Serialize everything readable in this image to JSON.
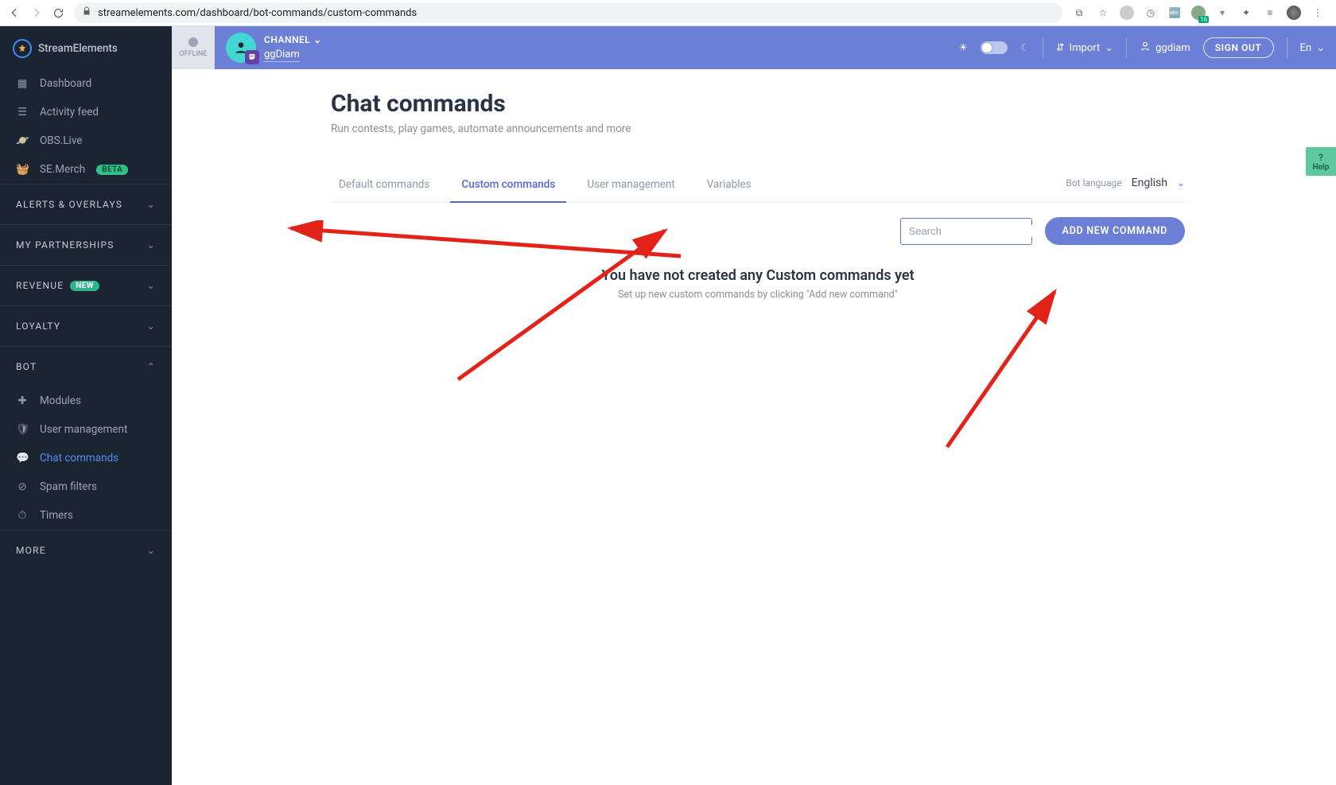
{
  "browser": {
    "url": "streamelements.com/dashboard/bot-commands/custom-commands",
    "ext_badge": "16"
  },
  "brand": "StreamElements",
  "sidebar": {
    "items": [
      {
        "label": "Dashboard"
      },
      {
        "label": "Activity feed"
      },
      {
        "label": "OBS.Live"
      },
      {
        "label": "SE.Merch",
        "badge": "BETA"
      }
    ],
    "sections": [
      {
        "label": "ALERTS & OVERLAYS",
        "open": false
      },
      {
        "label": "MY PARTNERSHIPS",
        "open": false
      },
      {
        "label": "REVENUE",
        "badge": "NEW",
        "open": false
      },
      {
        "label": "LOYALTY",
        "open": false
      },
      {
        "label": "BOT",
        "open": true,
        "items": [
          {
            "label": "Modules"
          },
          {
            "label": "User management"
          },
          {
            "label": "Chat commands",
            "active": true
          },
          {
            "label": "Spam filters"
          },
          {
            "label": "Timers"
          }
        ]
      },
      {
        "label": "MORE",
        "open": false
      }
    ]
  },
  "topbar": {
    "offline": "OFFLINE",
    "channel_label": "CHANNEL",
    "channel_name": "ggDiam",
    "import": "Import",
    "user": "ggdiam",
    "signout": "SIGN OUT",
    "lang": "En"
  },
  "page": {
    "title": "Chat commands",
    "subtitle": "Run contests, play games, automate announcements and more",
    "tabs": [
      {
        "label": "Default commands"
      },
      {
        "label": "Custom commands",
        "active": true
      },
      {
        "label": "User management"
      },
      {
        "label": "Variables"
      }
    ],
    "bot_language_label": "Bot language",
    "bot_language_value": "English",
    "search_placeholder": "Search",
    "add_button": "ADD NEW COMMAND",
    "empty_title": "You have not created any Custom commands yet",
    "empty_sub": "Set up new custom commands by clicking \"Add new command\"",
    "help": "Help"
  }
}
